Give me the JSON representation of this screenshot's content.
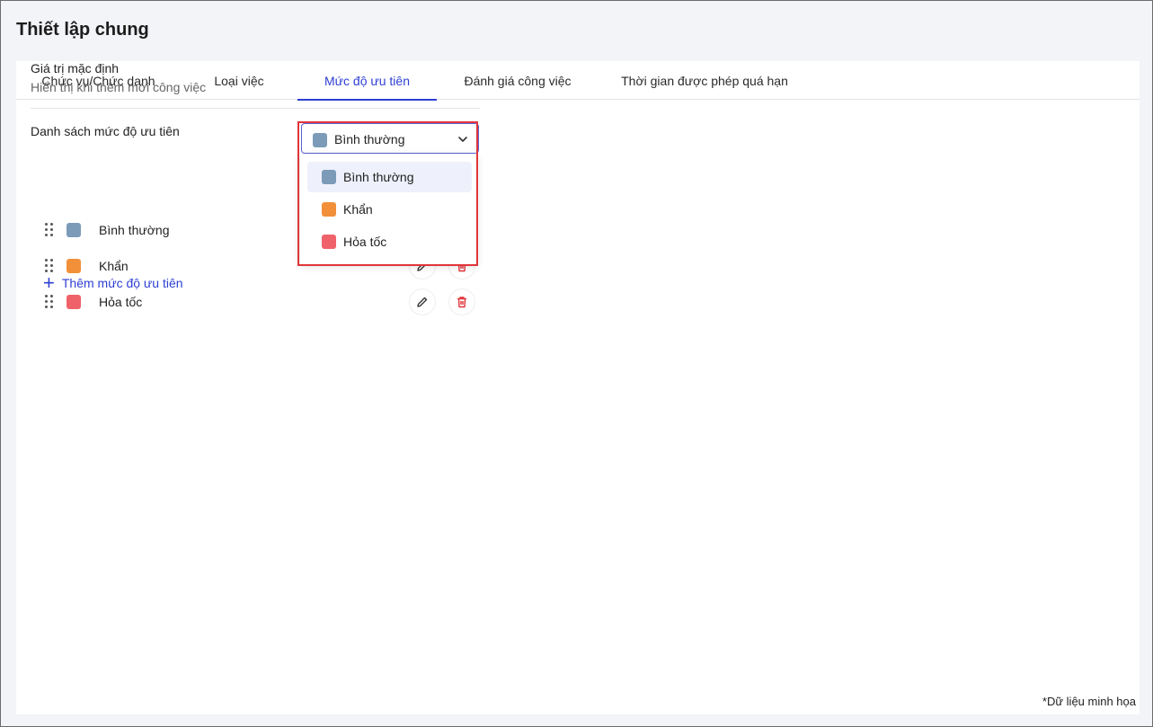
{
  "page": {
    "title": "Thiết lập chung",
    "footnote": "*Dữ liệu minh họa"
  },
  "tabs": [
    {
      "label": "Chức vụ/Chức danh"
    },
    {
      "label": "Loại việc"
    },
    {
      "label": "Mức độ ưu tiên"
    },
    {
      "label": "Đánh giá công việc"
    },
    {
      "label": "Thời gian được phép quá hạn"
    }
  ],
  "active_tab": "Mức độ ưu tiên",
  "default_value": {
    "label": "Giá trị mặc định",
    "description": "Hiển thị khi thêm mới công việc",
    "selected": "Bình thường",
    "selected_color": "#7b9bb8"
  },
  "dropdown": {
    "options": [
      {
        "label": "Bình thường",
        "color": "#7b9bb8"
      },
      {
        "label": "Khẩn",
        "color": "#f2903a"
      },
      {
        "label": "Hỏa tốc",
        "color": "#f0626a"
      }
    ]
  },
  "priority_list": {
    "title": "Danh sách mức độ ưu tiên",
    "items": [
      {
        "label": "Bình thường",
        "color": "#7b9bb8"
      },
      {
        "label": "Khẩn",
        "color": "#f2903a"
      },
      {
        "label": "Hỏa tốc",
        "color": "#f0626a"
      }
    ],
    "add_label": "Thêm mức độ ưu tiên"
  },
  "colors": {
    "accent": "#2d3fd3",
    "highlight": "#e0353a",
    "danger": "#e0353a"
  },
  "icons": [
    "drag-handle-icon",
    "pencil-icon",
    "trash-icon",
    "chevron-down-icon",
    "plus-icon"
  ]
}
